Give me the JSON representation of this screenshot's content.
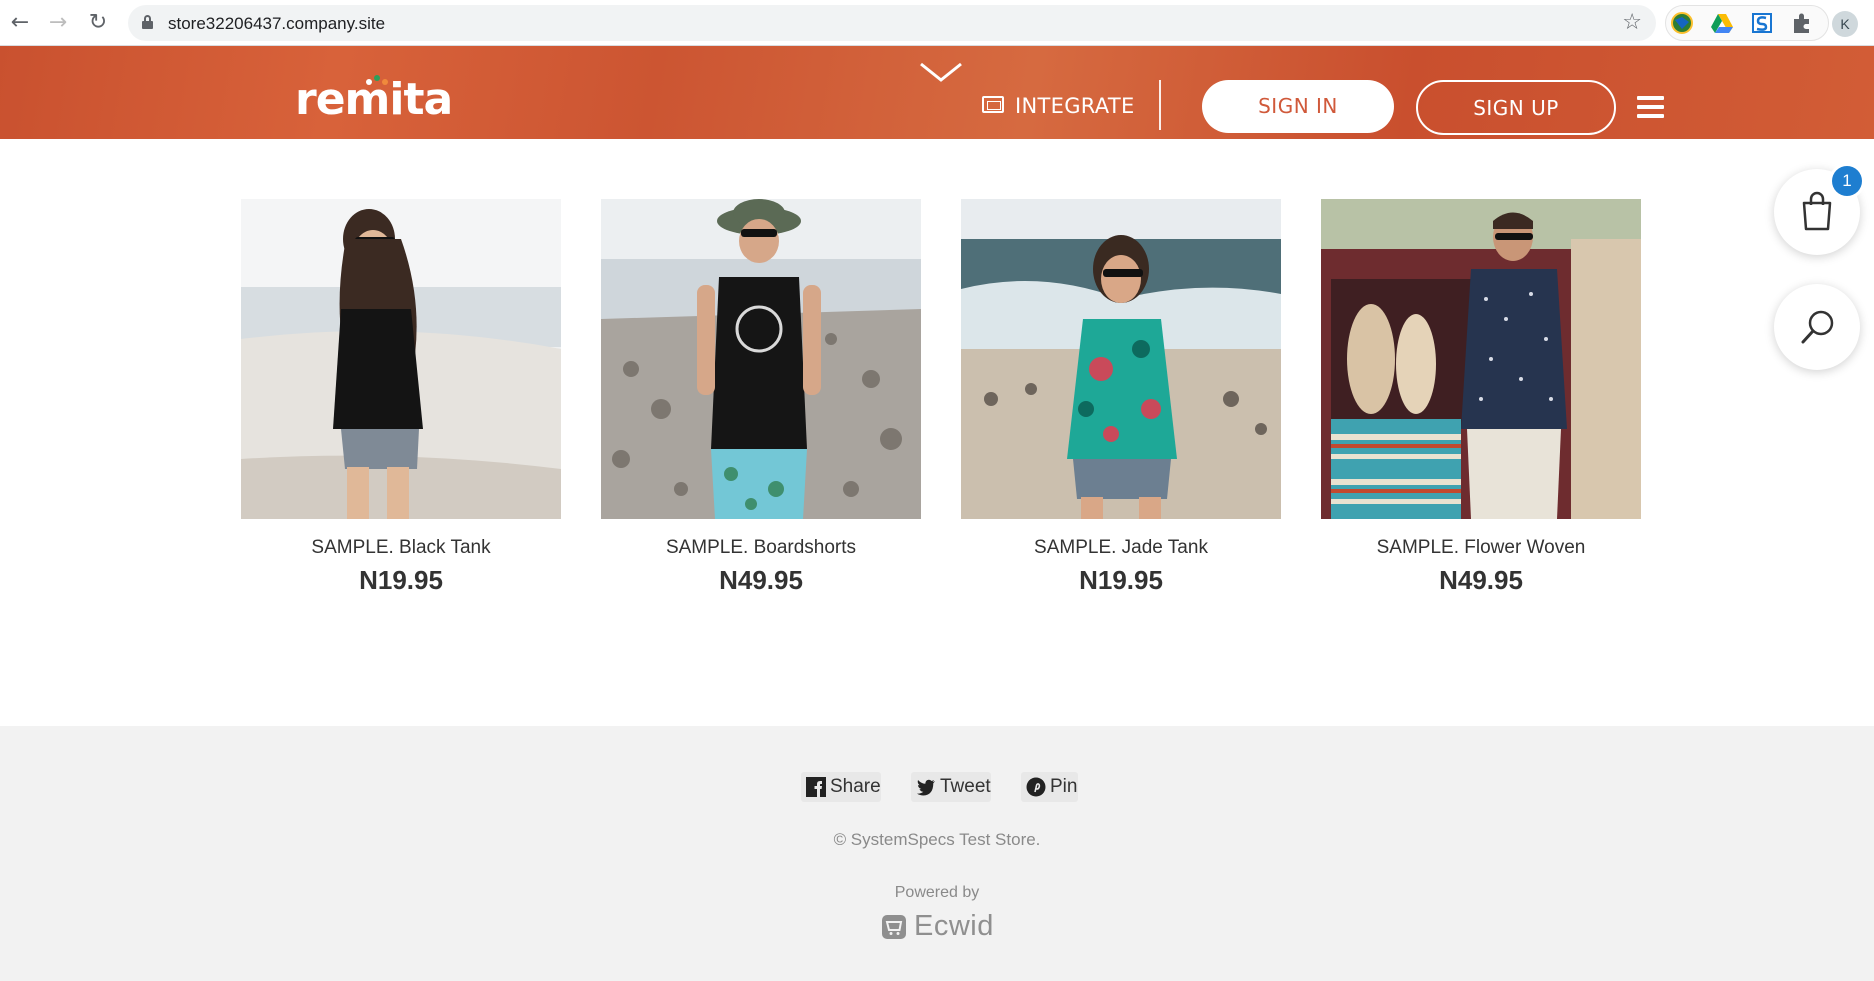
{
  "browser": {
    "url": "store32206437.company.site",
    "profile_initial": "K"
  },
  "header": {
    "logo_text": "remita",
    "integrate_label": "INTEGRATE",
    "sign_in_label": "SIGN IN",
    "sign_up_label": "SIGN UP",
    "colors": {
      "banner": "#cf5a35",
      "logo_dot_green": "#2e9e5b",
      "logo_dot_orange": "#f08a3c"
    }
  },
  "products": [
    {
      "name": "SAMPLE. Black Tank",
      "price": "N19.95"
    },
    {
      "name": "SAMPLE. Boardshorts",
      "price": "N49.95"
    },
    {
      "name": "SAMPLE. Jade Tank",
      "price": "N19.95"
    },
    {
      "name": "SAMPLE. Flower Woven",
      "price": "N49.95"
    }
  ],
  "cart": {
    "count": "1"
  },
  "footer": {
    "share": {
      "facebook": "Share",
      "twitter": "Tweet",
      "pinterest": "Pin"
    },
    "copyright": "© SystemSpecs Test Store.",
    "powered_by": "Powered by",
    "ecwid": "Ecwid"
  }
}
